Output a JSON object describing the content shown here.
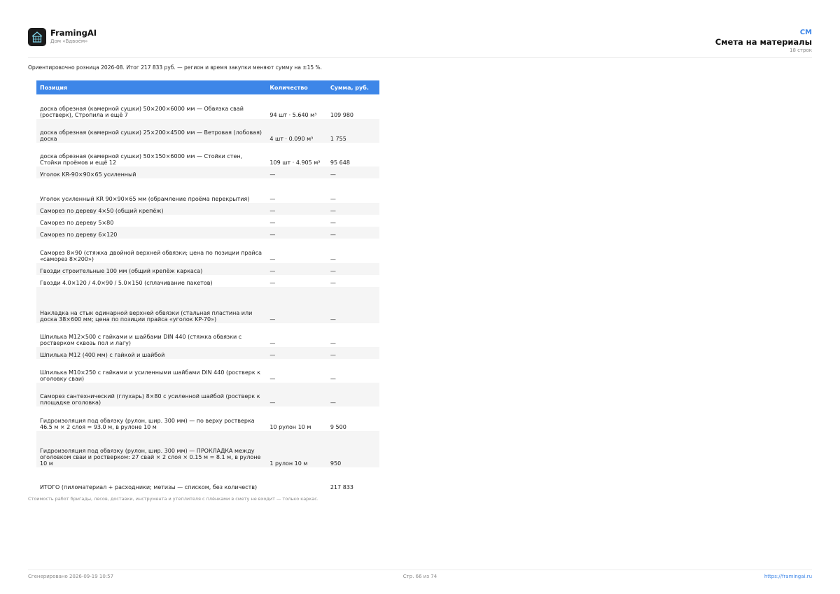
{
  "brand": {
    "name": "FramingAI",
    "subtitle": "Дом «Вдвоём»"
  },
  "header": {
    "code": "СМ",
    "title": "Смета на материалы",
    "count": "18 строк"
  },
  "intro": "Ориентировочно розница 2026-08. Итог 217 833 руб. — регион и время закупки меняют сумму на ±15 %.",
  "table": {
    "columns": [
      "Позиция",
      "Количество",
      "Сумма, руб."
    ],
    "rows": [
      {
        "item": "доска обрезная (камерной сушки) 50×200×6000 мм — Обвязка свай (ростверк), Стропила и ещё 7",
        "qty": "94 шт · 5.640 м³",
        "sum": "109 980"
      },
      {
        "item": "доска обрезная (камерной сушки) 25×200×4500 мм — Ветровая (лобовая) доска",
        "qty": "4 шт · 0.090 м³",
        "sum": "1 755"
      },
      {
        "item": "доска обрезная (камерной сушки) 50×150×6000 мм — Стойки стен, Стойки проёмов и ещё 12",
        "qty": "109 шт · 4.905 м³",
        "sum": "95 648"
      },
      {
        "item": "Уголок KR-90×90×65 усиленный",
        "qty": "—",
        "sum": "—"
      },
      {
        "item": "Уголок усиленный KR 90×90×65 мм (обрамление проёма перекрытия)",
        "qty": "—",
        "sum": "—"
      },
      {
        "item": "Саморез по дереву 4×50 (общий крепёж)",
        "qty": "—",
        "sum": "—"
      },
      {
        "item": "Саморез по дереву 5×80",
        "qty": "—",
        "sum": "—"
      },
      {
        "item": "Саморез по дереву 6×120",
        "qty": "—",
        "sum": "—"
      },
      {
        "item": "Саморез 8×90 (стяжка двойной верхней обвязки; цена по позиции прайса «саморез 8×200»)",
        "qty": "—",
        "sum": "—"
      },
      {
        "item": "Гвозди строительные 100 мм (общий крепёж каркаса)",
        "qty": "—",
        "sum": "—"
      },
      {
        "item": "Гвозди 4.0×120 / 4.0×90 / 5.0×150 (сплачивание пакетов)",
        "qty": "—",
        "sum": "—"
      },
      {
        "item": "Накладка на стык одинарной верхней обвязки (стальная пластина или доска 38×600 мм; цена по позиции прайса «уголок KP-70»)",
        "qty": "—",
        "sum": "—"
      },
      {
        "item": "Шпилька М12×500 с гайками и шайбами DIN 440 (стяжка обвязки с ростверком сквозь пол и лагу)",
        "qty": "—",
        "sum": "—"
      },
      {
        "item": "Шпилька М12 (400 мм) с гайкой и шайбой",
        "qty": "—",
        "sum": "—"
      },
      {
        "item": "Шпилька М10×250 с гайками и усиленными шайбами DIN 440 (ростверк к оголовку сваи)",
        "qty": "—",
        "sum": "—"
      },
      {
        "item": "Саморез сантехнический (глухарь) 8×80 с усиленной шайбой (ростверк к площадке оголовка)",
        "qty": "—",
        "sum": "—"
      },
      {
        "item": "Гидроизоляция под обвязку (рулон, шир. 300 мм) — по верху ростверка 46.5 м × 2 слоя = 93.0 м, в рулоне 10 м",
        "qty": "10 рулон 10 м",
        "sum": "9 500"
      },
      {
        "item": "Гидроизоляция под обвязку (рулон, шир. 300 мм) — ПРОКЛАДКА между оголовком сваи и ростверком: 27 свай × 2 слоя × 0.15 м = 8.1 м, в рулоне 10 м",
        "qty": "1 рулон 10 м",
        "sum": "950"
      },
      {
        "item": "ИТОГО (пиломатериал + расходники; метизы — списком, без количеств)",
        "qty": "",
        "sum": "217 833"
      }
    ]
  },
  "note": "Стоимость работ бригады, лесов, доставки, инструмента и утеплителя с плёнками в смету не входит — только каркас.",
  "footer": {
    "generated": "Сгенерировано 2026-09-19 10:57",
    "page": "Стр. 66 из 74",
    "url": "https://framingai.ru"
  }
}
